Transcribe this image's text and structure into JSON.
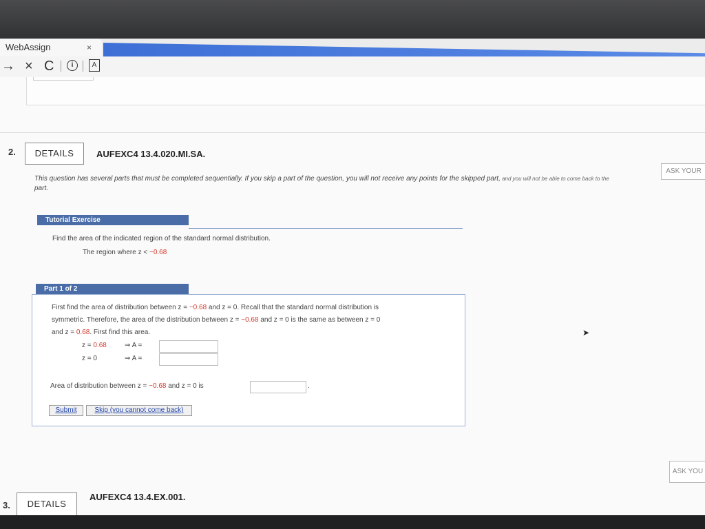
{
  "browser": {
    "tab_title": "WebAssign",
    "tab_close": "×",
    "back": "→",
    "stop": "×",
    "reload": "C",
    "info": "i",
    "ext": "A"
  },
  "question2": {
    "number": "2.",
    "details_label": "DETAILS",
    "code": "AUFEXC4 13.4.020.MI.SA.",
    "ask_label": "ASK YOUR",
    "intro_main": "This question has several parts that must be completed sequentially. If you skip a part of the question, you will not receive any points for the skipped part,",
    "intro_small": " and you will not be able to come back to the",
    "intro_end": "part.",
    "tutorial": {
      "header": "Tutorial Exercise",
      "prompt": "Find the area of the indicated region of the standard normal distribution.",
      "region_prefix": "The region where z < ",
      "region_value": "−0.68"
    },
    "part": {
      "header": "Part 1 of 2",
      "line1_a": "First find the area of distribution between z = ",
      "line1_v1": "−0.68",
      "line1_b": " and z = 0. Recall that the standard normal distribution is",
      "line2_a": "symmetric. Therefore, the area of the distribution between z = ",
      "line2_v1": "−0.68",
      "line2_b": " and z = 0 is the same as between z = 0",
      "line3_a": "and z = ",
      "line3_v": "0.68",
      "line3_b": ". First find this area.",
      "eq1_left": "z = ",
      "eq1_value": "0.68",
      "eq1_right": "⇒  A =",
      "eq2_left": "z = 0",
      "eq2_right": "⇒  A =",
      "area_a": "Area of distribution between z = ",
      "area_v": "−0.68",
      "area_b": " and z = 0 is",
      "area_end": ".",
      "submit_label": "Submit",
      "skip_label": "Skip (you cannot come back)"
    },
    "ask_label_2": "ASK YOU"
  },
  "question3": {
    "number": "3.",
    "details_label": "DETAILS",
    "code": "AUFEXC4 13.4.EX.001."
  }
}
